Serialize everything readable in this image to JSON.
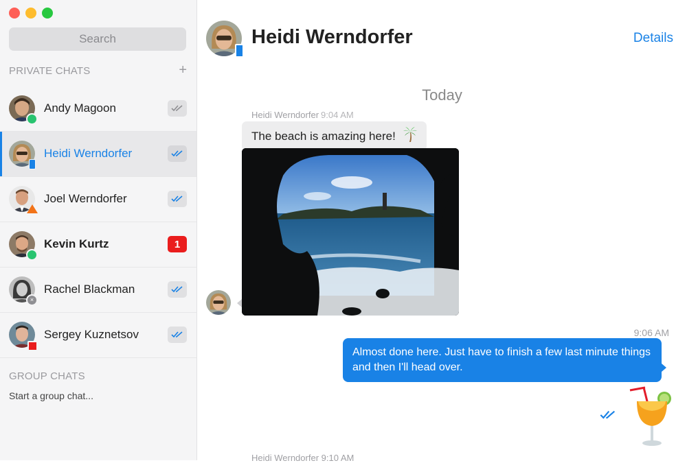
{
  "window": {
    "controls": [
      "close",
      "minimize",
      "zoom"
    ]
  },
  "sidebar": {
    "search_placeholder": "Search",
    "private_title": "PRIVATE CHATS",
    "add_label": "+",
    "chats": [
      {
        "name": "Andy Magoon",
        "status": "online",
        "badge": "read"
      },
      {
        "name": "Heidi Werndorfer",
        "status": "mobile",
        "badge": "read",
        "active": true
      },
      {
        "name": "Joel Werndorfer",
        "status": "away",
        "badge": "read"
      },
      {
        "name": "Kevin Kurtz",
        "status": "online",
        "badge": "unread",
        "unread_count": "1"
      },
      {
        "name": "Rachel Blackman",
        "status": "offline",
        "badge": "read"
      },
      {
        "name": "Sergey Kuznetsov",
        "status": "busy",
        "badge": "read"
      }
    ],
    "group_title": "GROUP CHATS",
    "group_hint": "Start a group chat..."
  },
  "conversation": {
    "contact_name": "Heidi Werndorfer",
    "details_label": "Details",
    "date_divider": "Today",
    "messages": [
      {
        "sender": "Heidi Werndorfer",
        "time": "9:04 AM",
        "text": "The beach is amazing here!",
        "emoji": "🌴"
      },
      {
        "time": "9:06 AM",
        "text": "Almost done here. Just have to finish a few last minute things and then I'll head over."
      }
    ],
    "next_sender": "Heidi Werndorfer",
    "next_time": "9:10 AM"
  },
  "colors": {
    "accent": "#1982e6",
    "online": "#29c470",
    "away": "#f27318",
    "busy": "#ea1d1d",
    "offline": "#8f8f93"
  },
  "icons": [
    "double-check-icon",
    "palm-tree-icon",
    "cocktail-sticker-icon"
  ]
}
